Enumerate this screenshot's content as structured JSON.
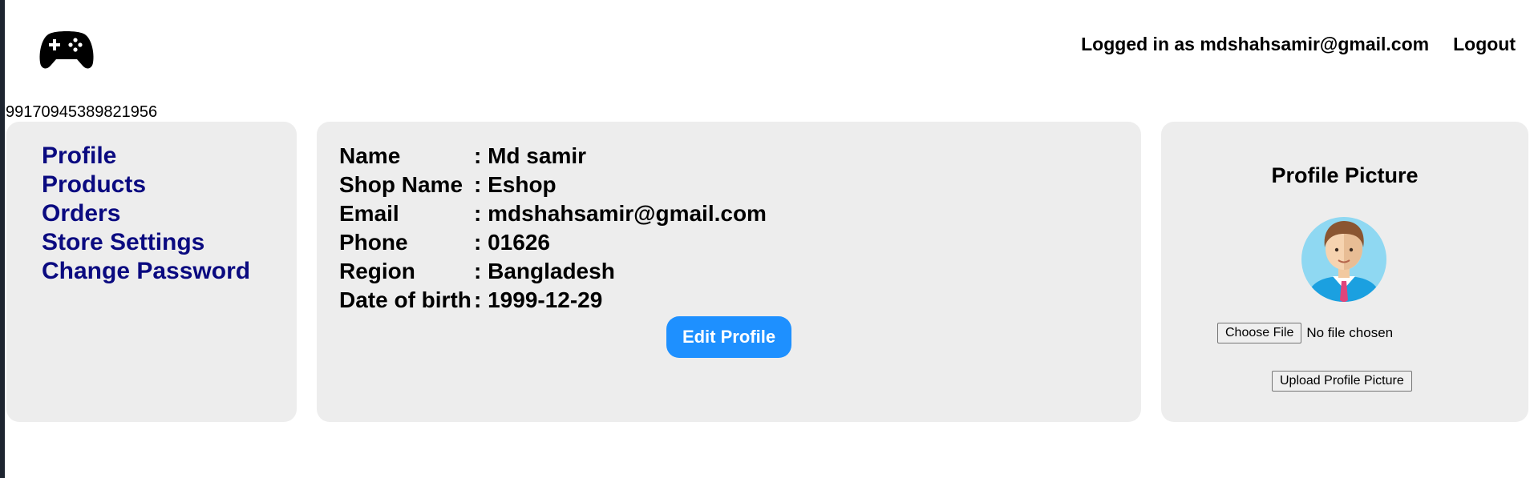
{
  "header": {
    "logo_icon": "gamepad-icon",
    "logged_in_text": "Logged in as mdshahsamir@gmail.com",
    "logout_label": "Logout"
  },
  "session_id": "99170945389821956",
  "sidebar": {
    "items": [
      {
        "label": "Profile"
      },
      {
        "label": "Products"
      },
      {
        "label": "Orders"
      },
      {
        "label": "Store Settings"
      },
      {
        "label": "Change Password"
      }
    ]
  },
  "profile": {
    "rows": [
      {
        "label": "Name",
        "value": ": Md samir"
      },
      {
        "label": "Shop Name",
        "value": ": Eshop"
      },
      {
        "label": "Email",
        "value": ": mdshahsamir@gmail.com"
      },
      {
        "label": "Phone",
        "value": ": 01626"
      },
      {
        "label": "Region",
        "value": ": Bangladesh"
      },
      {
        "label": "Date of birth",
        "value": ": 1999-12-29"
      }
    ],
    "edit_label": "Edit Profile"
  },
  "picture": {
    "title": "Profile Picture",
    "avatar_icon": "avatar-icon",
    "choose_label": "Choose File",
    "file_status": "No file chosen",
    "upload_label": "Upload Profile Picture"
  },
  "colors": {
    "accent": "#1e90ff",
    "nav_link": "#0a0a80",
    "panel_bg": "#ededed"
  }
}
